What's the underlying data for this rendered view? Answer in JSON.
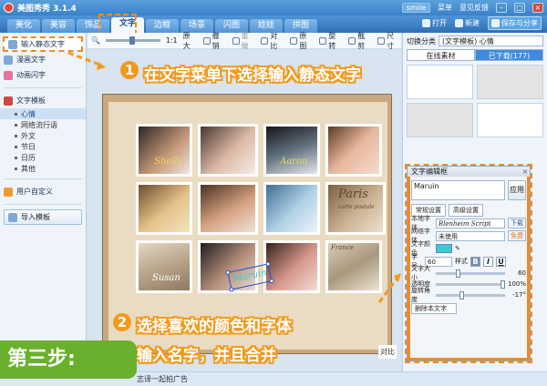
{
  "app": {
    "title": "美图秀秀 3.1.4",
    "user": "smile"
  },
  "title_links": [
    "菜单",
    "意见反馈"
  ],
  "tabs": [
    "美化",
    "美容",
    "饰品",
    "文字",
    "边框",
    "场景",
    "闪图",
    "娃娃",
    "拼图"
  ],
  "tab_actions": {
    "open": "打开",
    "new": "新建",
    "save": "保存与分享"
  },
  "sidebar": {
    "input_static": "输入静态文字",
    "comic_text": "漫画文字",
    "animated_text": "动画闪字",
    "text_template": "文字模板",
    "subcategories": [
      "心情",
      "网络流行语",
      "外文",
      "节日",
      "日历",
      "其他"
    ],
    "user_defined": "用户自定义",
    "import_template": "导入模板"
  },
  "toolbar": {
    "ratio": "1:1",
    "original_size": "原大",
    "undo": "撤销",
    "redo": "重做",
    "compare": "对比",
    "original": "原图",
    "rotate": "旋转",
    "crop": "截剪",
    "size": "尺寸"
  },
  "canvas": {
    "photo_texts": [
      "Shelly",
      "Aaron",
      "Susan"
    ],
    "paris_title": "Paris",
    "paris_sub": "carte postale",
    "france": "France"
  },
  "right_panel": {
    "switch_label": "切换分类",
    "category": "(文字模板) 心情",
    "online_tab": "在线素材",
    "download_tab": "已下载(177)"
  },
  "text_editor": {
    "title": "文字编辑框",
    "text_value": "Maruin",
    "apply": "应用",
    "tab_basic": "常规设置",
    "tab_advanced": "高级设置",
    "local_font_label": "本地字体",
    "local_font_value": "Blenheim Script",
    "download_btn": "下载",
    "net_font_label": "网络字体",
    "net_font_value": "未使用",
    "free_btn": "免费",
    "color_label": "文字颜色",
    "text_color": "#3fc8d8",
    "size_label": "字号",
    "size_value": "60",
    "style_label": "样式",
    "bold": "B",
    "italic": "I",
    "underline": "U",
    "text_size_label": "文字大小",
    "text_size_value": "60",
    "opacity_label": "透明度",
    "opacity_value": "100%",
    "rotate_label": "旋转角度",
    "rotate_value": "-17°",
    "delete_btn": "删除本文字"
  },
  "status_bar": {
    "text": "志译一起拍广告",
    "compare_hint": "对比"
  },
  "annotations": {
    "step1": "在文字菜单下选择输入静态文字",
    "step2_line1": "选择喜欢的颜色和字体",
    "step2_line2": "输入名字，并且合并",
    "step_label": "第三步:",
    "num1": "1",
    "num2": "2"
  }
}
